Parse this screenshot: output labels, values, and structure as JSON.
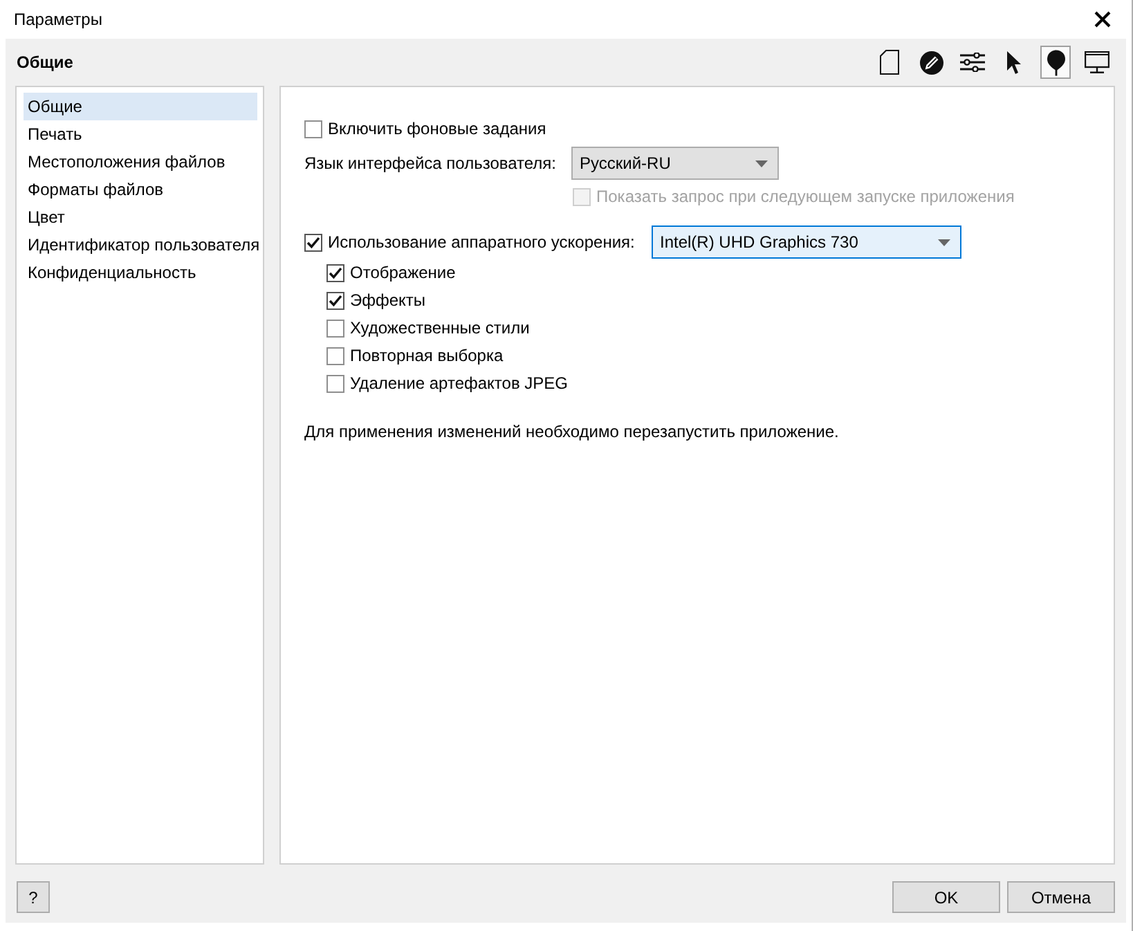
{
  "window": {
    "title": "Параметры"
  },
  "header": {
    "title": "Общие",
    "toolbar": [
      {
        "kind": "page",
        "selected": false
      },
      {
        "kind": "pen",
        "selected": false
      },
      {
        "kind": "sliders",
        "selected": false
      },
      {
        "kind": "pointer",
        "selected": false
      },
      {
        "kind": "balloon",
        "selected": true
      },
      {
        "kind": "monitor",
        "selected": false
      }
    ]
  },
  "sidebar": {
    "items": [
      {
        "label": "Общие",
        "selected": true
      },
      {
        "label": "Печать",
        "selected": false
      },
      {
        "label": "Местоположения файлов",
        "selected": false
      },
      {
        "label": "Форматы файлов",
        "selected": false
      },
      {
        "label": "Цвет",
        "selected": false
      },
      {
        "label": "Идентификатор пользователя",
        "selected": false
      },
      {
        "label": "Конфиденциальность",
        "selected": false
      }
    ]
  },
  "background_tasks": {
    "label": "Включить фоновые задания",
    "checked": false,
    "disabled": false
  },
  "language": {
    "label": "Язык интерфейса пользователя:",
    "value": "Русский-RU",
    "focused": false
  },
  "prompt_next_start": {
    "label": "Показать запрос при следующем запуске приложения",
    "checked": false,
    "disabled": true
  },
  "hardware_acceleration": {
    "label": "Использование аппаратного ускорения:",
    "checked": true,
    "disabled": false,
    "device": {
      "value": "Intel(R) UHD Graphics 730",
      "focused": true
    },
    "options": [
      {
        "label": "Отображение",
        "checked": true,
        "disabled": false
      },
      {
        "label": "Эффекты",
        "checked": true,
        "disabled": false
      },
      {
        "label": "Художественные стили",
        "checked": false,
        "disabled": false
      },
      {
        "label": "Повторная выборка",
        "checked": false,
        "disabled": false
      },
      {
        "label": "Удаление артефактов JPEG",
        "checked": false,
        "disabled": false
      }
    ]
  },
  "note": "Для применения изменений необходимо перезапустить приложение.",
  "footer": {
    "help": "?",
    "buttons": [
      "OK",
      "Отмена"
    ]
  }
}
